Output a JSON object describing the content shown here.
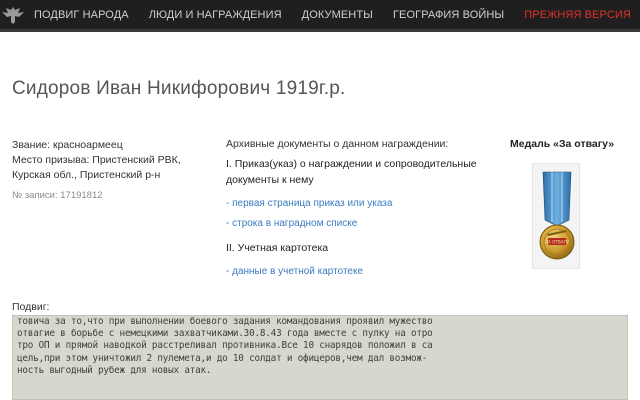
{
  "nav": {
    "items": [
      "ПОДВИГ НАРОДА",
      "ЛЮДИ И НАГРАЖДЕНИЯ",
      "ДОКУМЕНТЫ",
      "ГЕОГРАФИЯ ВОЙНЫ"
    ],
    "legacy": "ПРЕЖНЯЯ ВЕРСИЯ",
    "legacy_color": "#e0312a"
  },
  "person": {
    "title": "Сидоров Иван Никифорович 1919г.р.",
    "rank": "Звание: красноармеец",
    "conscription_1": "Место призыва: Пристенский РВК,",
    "conscription_2": "Курская обл., Пристенский р-н",
    "record_no": "№ записи: 17191812"
  },
  "documents": {
    "heading": "Архивные документы о данном награждении:",
    "section_1": "I. Приказ(указ) о награждении и сопроводительные документы к нему",
    "link_1": "- первая страница приказ или указа",
    "link_2": "- строка в наградном списке",
    "section_2": "II. Учетная картотека",
    "link_3": "- данные в учетной картотеке",
    "link_color": "#3a7bbf"
  },
  "medal": {
    "title": "Медаль «За отвагу»",
    "inscription": "ЗА ОТВАГУ"
  },
  "feat": {
    "label": "Подвиг:",
    "lines": [
      "товича за то,что при выполнении боевого задания командования проявил мужество",
      "отвагие в борьбе с немецкими захватчиками.30.8.43 года вместе с пулку на отро",
      "тро ОП и прямой наводкой расстреливал противника.Все 10 снарядов положил в са",
      "цель,при этом уничтожил 2 пулемета,и до 10 солдат и офицеров,чем дал возмож-",
      "ность выгодный рубеж для новых атак."
    ]
  }
}
